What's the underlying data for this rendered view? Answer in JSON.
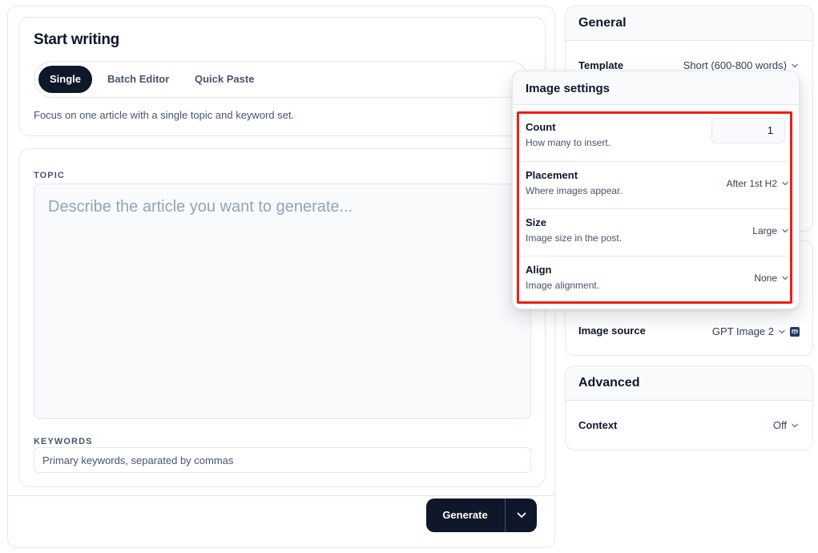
{
  "start": {
    "title": "Start writing",
    "tabs": [
      {
        "label": "Single"
      },
      {
        "label": "Batch Editor"
      },
      {
        "label": "Quick Paste"
      }
    ],
    "description": "Focus on one article with a single topic and keyword set."
  },
  "form": {
    "topic_label": "TOPIC",
    "topic_placeholder": "Describe the article you want to generate...",
    "keywords_label": "KEYWORDS",
    "keywords_placeholder": "Primary keywords, separated by commas"
  },
  "actions": {
    "generate_label": "Generate"
  },
  "general": {
    "title": "General",
    "template_label": "Template",
    "template_value": "Short (600-800 words)"
  },
  "media": {
    "image_source_label": "Image source",
    "image_source_value": "GPT Image 2"
  },
  "advanced": {
    "title": "Advanced",
    "context_label": "Context",
    "context_value": "Off"
  },
  "image_settings": {
    "title": "Image settings",
    "count": {
      "label": "Count",
      "description": "How many to insert.",
      "value": "1"
    },
    "placement": {
      "label": "Placement",
      "description": "Where images appear.",
      "value": "After 1st H2"
    },
    "size": {
      "label": "Size",
      "description": "Image size in the post.",
      "value": "Large"
    },
    "align": {
      "label": "Align",
      "description": "Image alignment.",
      "value": "None"
    }
  },
  "colors": {
    "primary": "#0f172a",
    "highlight": "#ef1f11",
    "muted_text": "#475569",
    "placeholder": "#94a3b8"
  }
}
